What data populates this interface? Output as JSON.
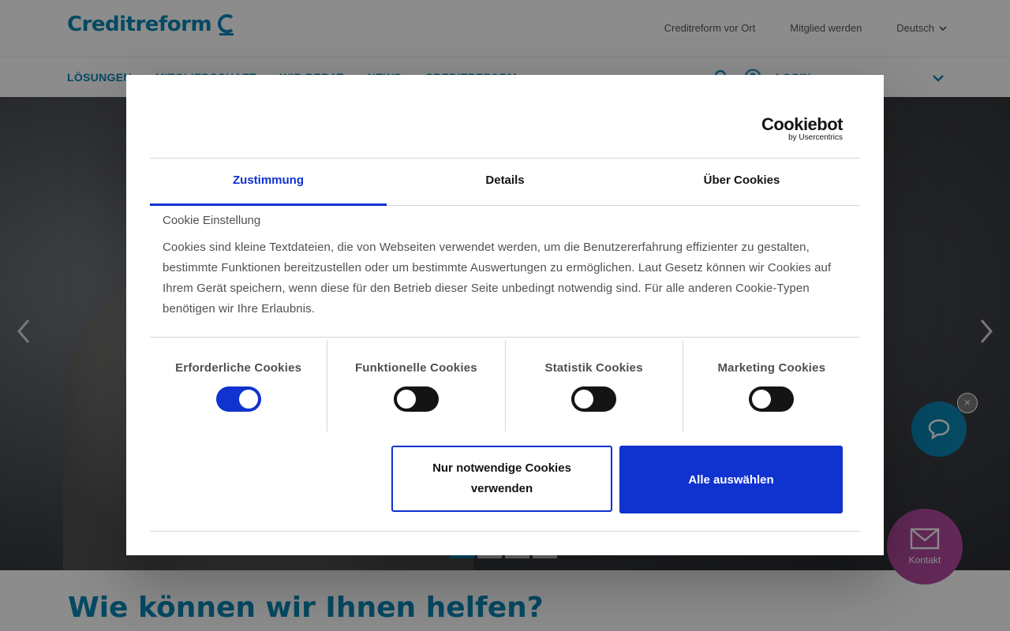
{
  "site": {
    "logo_text": "Creditreform",
    "top_links": [
      "Creditreform vor Ort",
      "Mitglied werden"
    ],
    "language": "Deutsch",
    "nav_items": [
      "LÖSUNGEN",
      "MITGLIEDSCHAFT",
      "WIR BERAT",
      "NEWS",
      "CREDITREFORM"
    ],
    "login_label": "LOGIN",
    "heading": "Wie können wir Ihnen helfen?",
    "contact_label": "Kontakt",
    "close_glyph": "×",
    "colors": {
      "brand": "#0a86b4",
      "contact": "#b24a9e"
    },
    "carousel": {
      "slides": 4,
      "active": 0
    }
  },
  "cookie_dialog": {
    "brand_main": "Cookiebot",
    "brand_sub": "by Usercentrics",
    "tabs": [
      "Zustimmung",
      "Details",
      "Über Cookies"
    ],
    "active_tab": "Zustimmung",
    "title": "Cookie Einstellung",
    "description": "Cookies sind kleine Textdateien, die von Webseiten verwendet werden, um die Benutzererfahrung effizienter zu gestalten, bestimmte Funktionen bereitzustellen oder um bestimmte Auswertungen zu ermöglichen. Laut Gesetz können wir Cookies auf Ihrem Gerät speichern, wenn diese für den Betrieb dieser Seite unbedingt notwendig sind. Für alle anderen Cookie-Typen benötigen wir Ihre Erlaubnis.",
    "toggles": [
      {
        "label": "Erforderliche Cookies",
        "on": true
      },
      {
        "label": "Funktionelle Cookies",
        "on": false
      },
      {
        "label": "Statistik Cookies",
        "on": false
      },
      {
        "label": "Marketing Cookies",
        "on": false
      }
    ],
    "btn_necessary": "Nur notwendige Cookies verwenden",
    "btn_all": "Alle auswählen",
    "colors": {
      "accent": "#1032cf"
    }
  }
}
